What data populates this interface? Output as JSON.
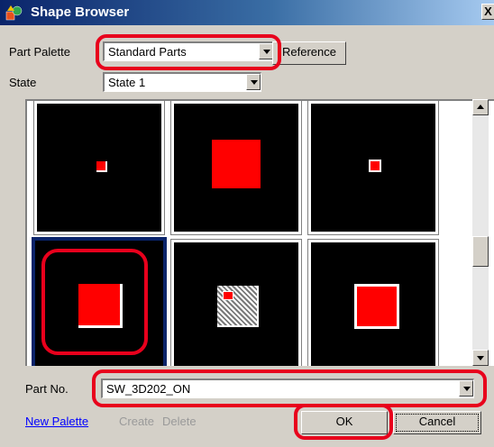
{
  "window": {
    "title": "Shape Browser",
    "close_glyph": "X"
  },
  "part_palette": {
    "label": "Part Palette",
    "value": "Standard Parts",
    "reference_label": "Reference"
  },
  "state": {
    "label": "State",
    "value": "State 1"
  },
  "parts_grid": [
    {
      "shape": "small-red-square"
    },
    {
      "shape": "large-red-square"
    },
    {
      "shape": "small-red-square-white-bevel"
    },
    {
      "shape": "red-square-white-bevel",
      "selected": true
    },
    {
      "shape": "gray-hatched-square-with-red-indicator"
    },
    {
      "shape": "red-square-white-border"
    }
  ],
  "part_no": {
    "label": "Part No.",
    "value": "SW_3D202_ON"
  },
  "footer": {
    "new_palette": "New Palette",
    "create": "Create",
    "delete": "Delete",
    "ok": "OK",
    "cancel": "Cancel"
  },
  "colors": {
    "highlight": "#e8001c",
    "shape_red": "#ff0000",
    "title_bar": "#0a246a"
  }
}
